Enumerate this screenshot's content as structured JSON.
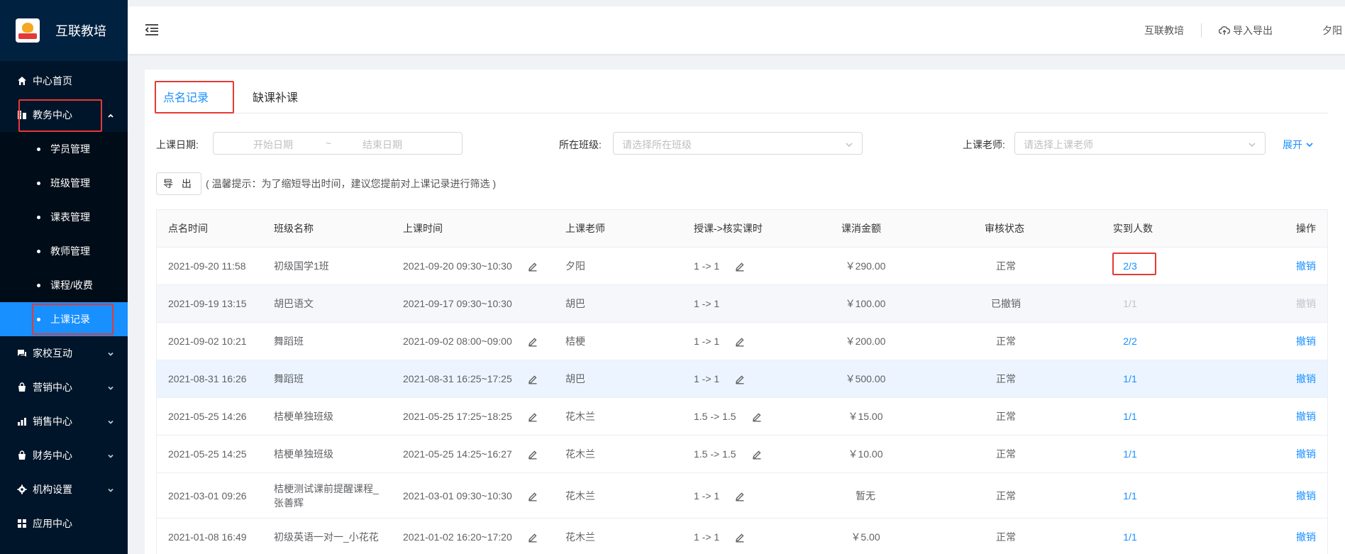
{
  "app": {
    "name": "互联教培"
  },
  "sidebar": {
    "items": [
      {
        "label": "中心首页",
        "icon": "home-icon"
      },
      {
        "label": "教务中心",
        "icon": "building-icon",
        "expanded": true
      },
      {
        "label": "家校互动",
        "icon": "chat-icon"
      },
      {
        "label": "营销中心",
        "icon": "bag-icon"
      },
      {
        "label": "销售中心",
        "icon": "chart-icon"
      },
      {
        "label": "财务中心",
        "icon": "wallet-icon"
      },
      {
        "label": "机构设置",
        "icon": "gear-icon"
      },
      {
        "label": "应用中心",
        "icon": "grid-icon"
      }
    ],
    "sub_items": [
      "学员管理",
      "班级管理",
      "课表管理",
      "教师管理",
      "课程/收费",
      "上课记录"
    ],
    "active_sub": "上课记录"
  },
  "header": {
    "org": "互联教培",
    "import_export": "导入导出",
    "user": "夕阳"
  },
  "tabs": [
    {
      "label": "点名记录",
      "active": true
    },
    {
      "label": "缺课补课",
      "active": false
    }
  ],
  "filters": {
    "date_label": "上课日期:",
    "start_placeholder": "开始日期",
    "range_sep": "~",
    "end_placeholder": "结束日期",
    "class_label": "所在班级:",
    "class_placeholder": "请选择所在班级",
    "teacher_label": "上课老师:",
    "teacher_placeholder": "请选择上课老师",
    "expand": "展开"
  },
  "export": {
    "button": "导 出",
    "tip": "( 温馨提示：为了缩短导出时间，建议您提前对上课记录进行筛选 )"
  },
  "table": {
    "columns": [
      "点名时间",
      "班级名称",
      "上课时间",
      "上课老师",
      "授课->核实课时",
      "课消金额",
      "审核状态",
      "实到人数",
      "操作"
    ],
    "rows": [
      {
        "roll_time": "2021-09-20 11:58",
        "class": "初级国学1班",
        "lesson_time": "2021-09-20 09:30~10:30",
        "teacher": "夕阳",
        "hours": "1 -> 1",
        "amount": "￥290.00",
        "status": "正常",
        "attendance": "2/3",
        "action": "撤销",
        "editable": true
      },
      {
        "roll_time": "2021-09-19 13:15",
        "class": "胡巴语文",
        "lesson_time": "2021-09-17 09:30~10:30",
        "teacher": "胡巴",
        "hours": "1 -> 1",
        "amount": "￥100.00",
        "status": "已撤销",
        "attendance": "1/1",
        "action": "撤销",
        "editable": false
      },
      {
        "roll_time": "2021-09-02 10:21",
        "class": "舞蹈班",
        "lesson_time": "2021-09-02 08:00~09:00",
        "teacher": "桔梗",
        "hours": "1 -> 1",
        "amount": "￥200.00",
        "status": "正常",
        "attendance": "2/2",
        "action": "撤销",
        "editable": true
      },
      {
        "roll_time": "2021-08-31 16:26",
        "class": "舞蹈班",
        "lesson_time": "2021-08-31 16:25~17:25",
        "teacher": "胡巴",
        "hours": "1 -> 1",
        "amount": "￥500.00",
        "status": "正常",
        "attendance": "1/1",
        "action": "撤销",
        "editable": true
      },
      {
        "roll_time": "2021-05-25 14:26",
        "class": "桔梗单独班级",
        "lesson_time": "2021-05-25 17:25~18:25",
        "teacher": "花木兰",
        "hours": "1.5 -> 1.5",
        "amount": "￥15.00",
        "status": "正常",
        "attendance": "1/1",
        "action": "撤销",
        "editable": true
      },
      {
        "roll_time": "2021-05-25 14:25",
        "class": "桔梗单独班级",
        "lesson_time": "2021-05-25 14:25~16:27",
        "teacher": "花木兰",
        "hours": "1.5 -> 1.5",
        "amount": "￥10.00",
        "status": "正常",
        "attendance": "1/1",
        "action": "撤销",
        "editable": true
      },
      {
        "roll_time": "2021-03-01 09:26",
        "class": "桔梗测试课前提醒课程_张善辉",
        "class_line1": "桔梗测试课前提醒课程_",
        "class_line2": "张善辉",
        "lesson_time": "2021-03-01 09:30~10:30",
        "teacher": "花木兰",
        "hours": "1 -> 1",
        "amount": "暂无",
        "status": "正常",
        "attendance": "1/1",
        "action": "撤销",
        "editable": true
      },
      {
        "roll_time": "2021-01-08 16:49",
        "class": "初级英语一对一_小花花",
        "lesson_time": "2021-01-02 16:20~17:20",
        "teacher": "花木兰",
        "hours": "1 -> 1",
        "amount": "￥5.00",
        "status": "正常",
        "attendance": "1/1",
        "action": "撤销",
        "editable": true
      }
    ]
  },
  "colors": {
    "sidebar_bg": "#001529",
    "active": "#1890ff",
    "highlight": "#e53935"
  }
}
